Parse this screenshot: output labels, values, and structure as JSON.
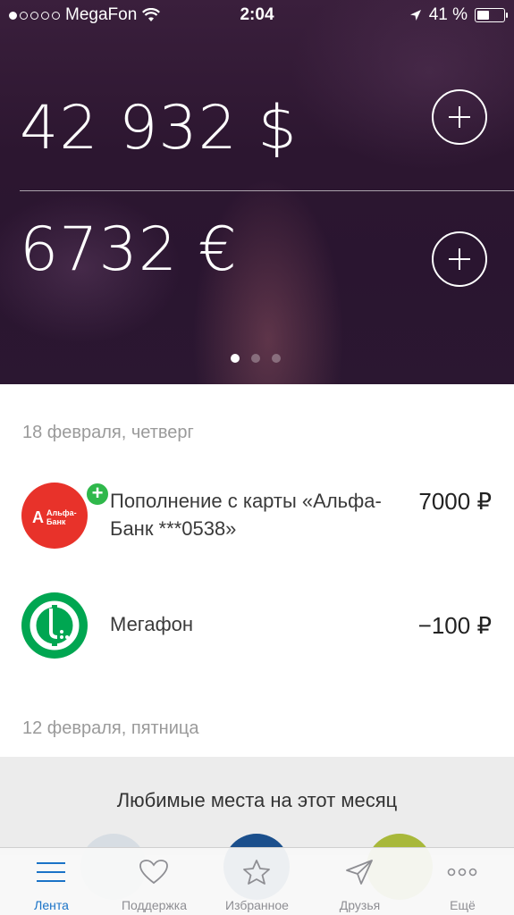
{
  "status_bar": {
    "carrier": "MegaFon",
    "time": "2:04",
    "battery": "41 %"
  },
  "balances": [
    {
      "amount": "42 932 $"
    },
    {
      "amount": "6732 €"
    }
  ],
  "pager": {
    "pages": 3,
    "active": 1
  },
  "feed": {
    "date1": "18 февраля, четверг",
    "transactions": [
      {
        "title": "Пополнение с карты «Альфа-Банк ***0538»",
        "amount": "7000 ₽",
        "logo_text": "Альфа-Банк"
      },
      {
        "title": "Мегафон",
        "amount": "−100 ₽"
      }
    ],
    "date2": "12 февраля, пятница"
  },
  "favorites": {
    "title": "Любимые места на этот месяц"
  },
  "tabs": [
    {
      "label": "Лента",
      "icon": "menu-icon",
      "active": true
    },
    {
      "label": "Поддержка",
      "icon": "heart-icon"
    },
    {
      "label": "Избранное",
      "icon": "star-icon"
    },
    {
      "label": "Друзья",
      "icon": "send-icon"
    },
    {
      "label": "Ещё",
      "icon": "more-icon"
    }
  ],
  "colors": {
    "accent": "#1a73c7",
    "alfa_red": "#e8322a",
    "megafon_green": "#00a651",
    "badge_green": "#2fb84b"
  }
}
